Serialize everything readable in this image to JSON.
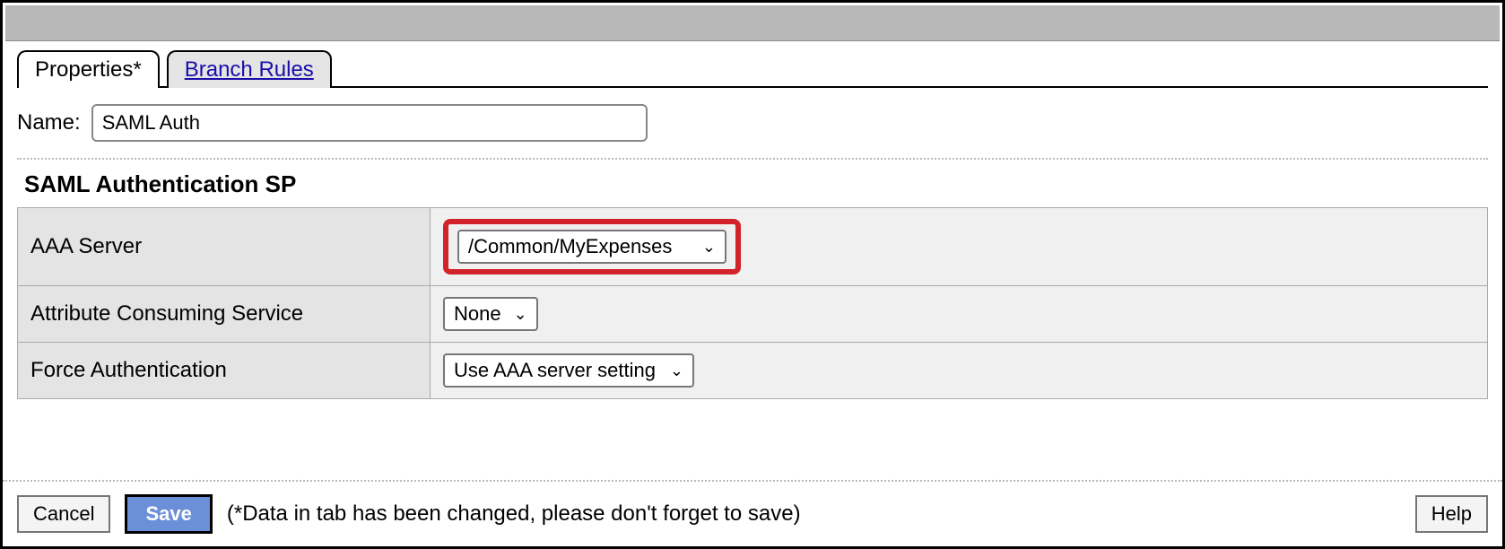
{
  "tabs": {
    "properties": "Properties*",
    "branch_rules": "Branch Rules"
  },
  "form": {
    "name_label": "Name:",
    "name_value": "SAML Auth",
    "section_title": "SAML Authentication SP",
    "rows": {
      "aaa_server": {
        "label": "AAA Server",
        "value": "/Common/MyExpenses"
      },
      "attr_consuming": {
        "label": "Attribute Consuming Service",
        "value": "None"
      },
      "force_auth": {
        "label": "Force Authentication",
        "value": "Use AAA server setting"
      }
    }
  },
  "footer": {
    "cancel": "Cancel",
    "save": "Save",
    "note": "(*Data in tab has been changed, please don't forget to save)",
    "help": "Help"
  }
}
